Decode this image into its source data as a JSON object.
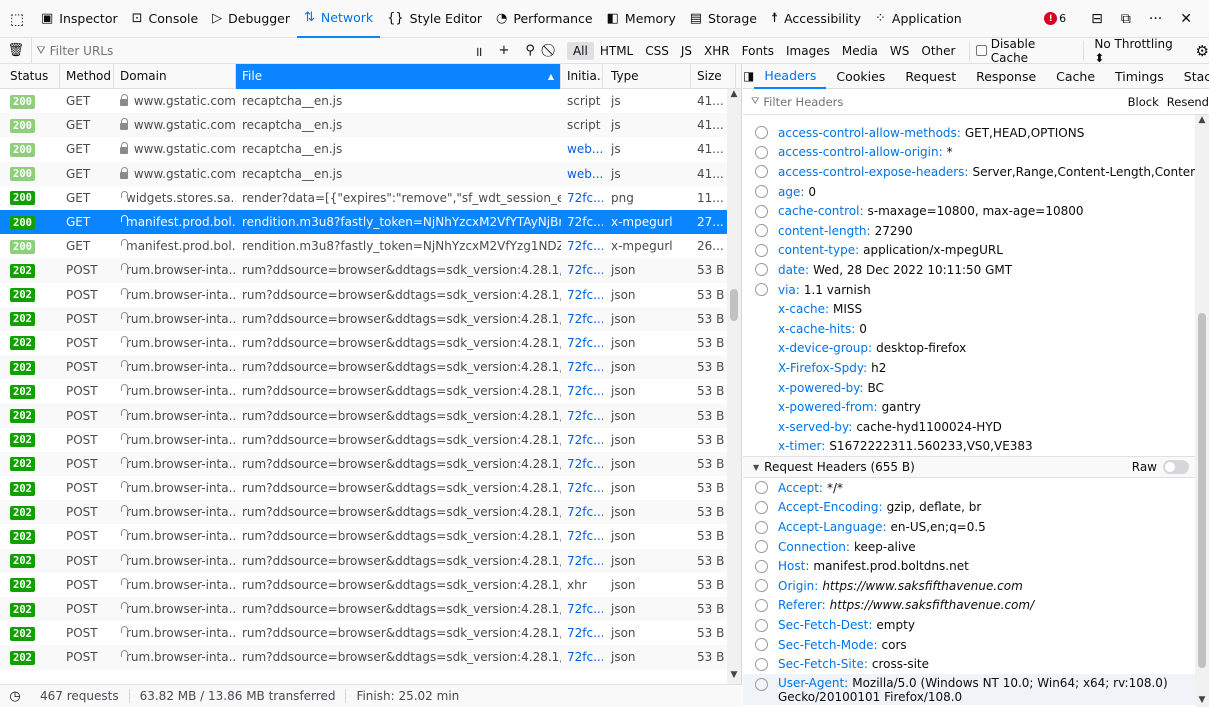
{
  "toolbar": {
    "tabs": [
      {
        "label": "Inspector",
        "icon": "inspector-icon",
        "glyph": "▣"
      },
      {
        "label": "Console",
        "icon": "console-icon",
        "glyph": "⊡"
      },
      {
        "label": "Debugger",
        "icon": "debugger-icon",
        "glyph": "▷"
      },
      {
        "label": "Network",
        "icon": "network-icon",
        "glyph": "⇅",
        "active": true
      },
      {
        "label": "Style Editor",
        "icon": "style-editor-icon",
        "glyph": "{}"
      },
      {
        "label": "Performance",
        "icon": "performance-icon",
        "glyph": "◔"
      },
      {
        "label": "Memory",
        "icon": "memory-icon",
        "glyph": "◧"
      },
      {
        "label": "Storage",
        "icon": "storage-icon",
        "glyph": "▤"
      },
      {
        "label": "Accessibility",
        "icon": "accessibility-icon",
        "glyph": "☨"
      },
      {
        "label": "Application",
        "icon": "application-icon",
        "glyph": "⁘"
      }
    ],
    "error_count": "6"
  },
  "filterbar": {
    "placeholder": "Filter URLs",
    "type_filters": [
      "All",
      "HTML",
      "CSS",
      "JS",
      "XHR",
      "Fonts",
      "Images",
      "Media",
      "WS",
      "Other"
    ],
    "disable_cache": "Disable Cache",
    "throttling": "No Throttling ⬍"
  },
  "columns": {
    "status": "Status",
    "method": "Method",
    "domain": "Domain",
    "file": "File",
    "initiator": "Initia...",
    "type": "Type",
    "size": "Size"
  },
  "requests": [
    {
      "status": "200",
      "method": "GET",
      "domain": "www.gstatic.com",
      "file": "recaptcha__en.js",
      "initiator": "script",
      "type": "js",
      "size": "41...",
      "muted": true
    },
    {
      "status": "200",
      "method": "GET",
      "domain": "www.gstatic.com",
      "file": "recaptcha__en.js",
      "initiator": "script",
      "type": "js",
      "size": "41...",
      "muted": true
    },
    {
      "status": "200",
      "method": "GET",
      "domain": "www.gstatic.com",
      "file": "recaptcha__en.js",
      "initiator": "web...",
      "type": "js",
      "size": "41...",
      "muted": true,
      "link": true
    },
    {
      "status": "200",
      "method": "GET",
      "domain": "www.gstatic.com",
      "file": "recaptcha__en.js",
      "initiator": "web...",
      "type": "js",
      "size": "41...",
      "muted": true,
      "link": true
    },
    {
      "status": "200",
      "method": "GET",
      "domain": "widgets.stores.sa...",
      "file": "render?data=[{\"expires\":\"remove\",\"sf_wdt_session_expiration_ses:",
      "initiator": "72fc...",
      "type": "png",
      "size": "11...",
      "link": true
    },
    {
      "status": "200",
      "method": "GET",
      "domain": "manifest.prod.bol...",
      "file": "rendition.m3u8?fastly_token=NjNhYzcxM2VfYTAyNjBmNjk0ZjFjN",
      "initiator": "72fc...",
      "type": "x-mpegurl",
      "size": "27...",
      "selected": true
    },
    {
      "status": "200",
      "method": "GET",
      "domain": "manifest.prod.bol...",
      "file": "rendition.m3u8?fastly_token=NjNhYzcxM2VfYzg1NDZjYWFjMDc",
      "initiator": "72fc...",
      "type": "x-mpegurl",
      "size": "26...",
      "muted": true,
      "link": true
    },
    {
      "status": "202",
      "method": "POST",
      "domain": "rum.browser-inta...",
      "file": "rum?ddsource=browser&ddtags=sdk_version:4.28.1,apixhr,env:",
      "initiator": "72fc...",
      "type": "json",
      "size": "53 B",
      "link": true
    },
    {
      "status": "202",
      "method": "POST",
      "domain": "rum.browser-inta...",
      "file": "rum?ddsource=browser&ddtags=sdk_version:4.28.1,apixhr,env:",
      "initiator": "72fc...",
      "type": "json",
      "size": "53 B",
      "link": true
    },
    {
      "status": "202",
      "method": "POST",
      "domain": "rum.browser-inta...",
      "file": "rum?ddsource=browser&ddtags=sdk_version:4.28.1,apixhr,env:",
      "initiator": "72fc...",
      "type": "json",
      "size": "53 B",
      "link": true
    },
    {
      "status": "202",
      "method": "POST",
      "domain": "rum.browser-inta...",
      "file": "rum?ddsource=browser&ddtags=sdk_version:4.28.1,apixhr,env:",
      "initiator": "72fc...",
      "type": "json",
      "size": "53 B",
      "link": true
    },
    {
      "status": "202",
      "method": "POST",
      "domain": "rum.browser-inta...",
      "file": "rum?ddsource=browser&ddtags=sdk_version:4.28.1,apixhr,env:",
      "initiator": "72fc...",
      "type": "json",
      "size": "53 B",
      "link": true
    },
    {
      "status": "202",
      "method": "POST",
      "domain": "rum.browser-inta...",
      "file": "rum?ddsource=browser&ddtags=sdk_version:4.28.1,apixhr,env:",
      "initiator": "72fc...",
      "type": "json",
      "size": "53 B",
      "link": true
    },
    {
      "status": "202",
      "method": "POST",
      "domain": "rum.browser-inta...",
      "file": "rum?ddsource=browser&ddtags=sdk_version:4.28.1,apixhr,env:",
      "initiator": "72fc...",
      "type": "json",
      "size": "53 B",
      "link": true
    },
    {
      "status": "202",
      "method": "POST",
      "domain": "rum.browser-inta...",
      "file": "rum?ddsource=browser&ddtags=sdk_version:4.28.1,apixhr,env:",
      "initiator": "72fc...",
      "type": "json",
      "size": "53 B",
      "link": true
    },
    {
      "status": "202",
      "method": "POST",
      "domain": "rum.browser-inta...",
      "file": "rum?ddsource=browser&ddtags=sdk_version:4.28.1,apixhr,env:",
      "initiator": "72fc...",
      "type": "json",
      "size": "53 B",
      "link": true
    },
    {
      "status": "202",
      "method": "POST",
      "domain": "rum.browser-inta...",
      "file": "rum?ddsource=browser&ddtags=sdk_version:4.28.1,apixhr,env:",
      "initiator": "72fc...",
      "type": "json",
      "size": "53 B",
      "link": true
    },
    {
      "status": "202",
      "method": "POST",
      "domain": "rum.browser-inta...",
      "file": "rum?ddsource=browser&ddtags=sdk_version:4.28.1,apixhr,env:",
      "initiator": "72fc...",
      "type": "json",
      "size": "53 B",
      "link": true
    },
    {
      "status": "202",
      "method": "POST",
      "domain": "rum.browser-inta...",
      "file": "rum?ddsource=browser&ddtags=sdk_version:4.28.1,apixhr,env:",
      "initiator": "72fc...",
      "type": "json",
      "size": "53 B",
      "link": true
    },
    {
      "status": "202",
      "method": "POST",
      "domain": "rum.browser-inta...",
      "file": "rum?ddsource=browser&ddtags=sdk_version:4.28.1,apixhr,env:",
      "initiator": "72fc...",
      "type": "json",
      "size": "53 B",
      "link": true
    },
    {
      "status": "202",
      "method": "POST",
      "domain": "rum.browser-inta...",
      "file": "rum?ddsource=browser&ddtags=sdk_version:4.28.1,apixhr,env:",
      "initiator": "xhr",
      "type": "json",
      "size": "53 B"
    },
    {
      "status": "202",
      "method": "POST",
      "domain": "rum.browser-inta...",
      "file": "rum?ddsource=browser&ddtags=sdk_version:4.28.1,apixhr,env:",
      "initiator": "72fc...",
      "type": "json",
      "size": "53 B",
      "link": true
    },
    {
      "status": "202",
      "method": "POST",
      "domain": "rum.browser-inta...",
      "file": "rum?ddsource=browser&ddtags=sdk_version:4.28.1,apixhr,env:",
      "initiator": "72fc...",
      "type": "json",
      "size": "53 B",
      "link": true
    },
    {
      "status": "202",
      "method": "POST",
      "domain": "rum.browser-inta...",
      "file": "rum?ddsource=browser&ddtags=sdk_version:4.28.1,apixhr,env:",
      "initiator": "72fc...",
      "type": "json",
      "size": "53 B",
      "link": true
    }
  ],
  "statusbar": {
    "requests": "467 requests",
    "transferred": "63.82 MB / 13.86 MB transferred",
    "finish": "Finish: 25.02 min"
  },
  "sidepanel": {
    "tabs": [
      "Headers",
      "Cookies",
      "Request",
      "Response",
      "Cache",
      "Timings",
      "Stacl"
    ],
    "active_tab": "Headers",
    "filter_placeholder": "Filter Headers",
    "options": [
      "Block",
      "Resend"
    ],
    "response_headers": [
      {
        "name": "access-control-allow-methods:",
        "value": "GET,HEAD,OPTIONS",
        "help": true
      },
      {
        "name": "access-control-allow-origin:",
        "value": "*",
        "help": true
      },
      {
        "name": "access-control-expose-headers:",
        "value": "Server,Range,Content-Length,Content-Range",
        "help": true
      },
      {
        "name": "age:",
        "value": "0",
        "help": true
      },
      {
        "name": "cache-control:",
        "value": "s-maxage=10800, max-age=10800",
        "help": true
      },
      {
        "name": "content-length:",
        "value": "27290",
        "help": true
      },
      {
        "name": "content-type:",
        "value": "application/x-mpegURL",
        "help": true
      },
      {
        "name": "date:",
        "value": "Wed, 28 Dec 2022 10:11:50 GMT",
        "help": true
      },
      {
        "name": "via:",
        "value": "1.1 varnish",
        "help": true
      },
      {
        "name": "x-cache:",
        "value": "MISS",
        "help": false
      },
      {
        "name": "x-cache-hits:",
        "value": "0",
        "help": false
      },
      {
        "name": "x-device-group:",
        "value": "desktop-firefox",
        "help": false
      },
      {
        "name": "X-Firefox-Spdy:",
        "value": "h2",
        "help": false
      },
      {
        "name": "x-powered-by:",
        "value": "BC",
        "help": false
      },
      {
        "name": "x-powered-from:",
        "value": "gantry",
        "help": false
      },
      {
        "name": "x-served-by:",
        "value": "cache-hyd1100024-HYD",
        "help": false
      },
      {
        "name": "x-timer:",
        "value": "S1672222311.560233,VS0,VE383",
        "help": false
      }
    ],
    "request_section": "Request Headers (655 B)",
    "raw_label": "Raw",
    "request_headers": [
      {
        "name": "Accept:",
        "value": "*/*"
      },
      {
        "name": "Accept-Encoding:",
        "value": "gzip, deflate, br"
      },
      {
        "name": "Accept-Language:",
        "value": "en-US,en;q=0.5"
      },
      {
        "name": "Connection:",
        "value": "keep-alive"
      },
      {
        "name": "Host:",
        "value": "manifest.prod.boltdns.net"
      },
      {
        "name": "Origin:",
        "value": "https://www.saksfifthavenue.com",
        "italic": true
      },
      {
        "name": "Referer:",
        "value": "https://www.saksfifthavenue.com/",
        "italic": true
      },
      {
        "name": "Sec-Fetch-Dest:",
        "value": "empty"
      },
      {
        "name": "Sec-Fetch-Mode:",
        "value": "cors"
      },
      {
        "name": "Sec-Fetch-Site:",
        "value": "cross-site"
      },
      {
        "name": "User-Agent:",
        "value": "Mozilla/5.0 (Windows NT 10.0; Win64; x64; rv:108.0) Gecko/20100101 Firefox/108.0"
      }
    ]
  }
}
